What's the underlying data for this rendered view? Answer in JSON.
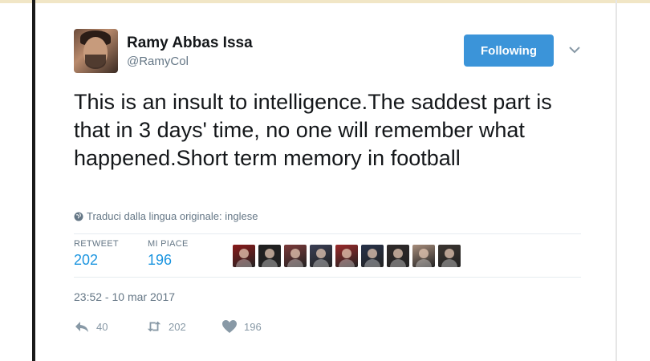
{
  "author": {
    "name": "Ramy Abbas Issa",
    "handle": "@RamyCol",
    "avatar_icon": "profile-photo"
  },
  "follow_button": {
    "label": "Following",
    "color": "#3b94d9"
  },
  "tweet": {
    "text": "This is an insult to intelligence.The saddest part is that in 3 days' time, no one will remember what happened.Short term memory in football",
    "translate_link": "Traduci dalla lingua originale: inglese"
  },
  "stats": {
    "retweets_label": "RETWEET",
    "retweets_count": "202",
    "likes_label": "MI PIACE",
    "likes_count": "196"
  },
  "likers": [
    {
      "icon": "liker-avatar-1",
      "color": "#8a1a1a"
    },
    {
      "icon": "liker-avatar-2",
      "color": "#1f1f1f"
    },
    {
      "icon": "liker-avatar-3",
      "color": "#7c3a3a"
    },
    {
      "icon": "liker-avatar-4",
      "color": "#3a3f55"
    },
    {
      "icon": "liker-avatar-5",
      "color": "#9b2a2a"
    },
    {
      "icon": "liker-avatar-6",
      "color": "#27324a"
    },
    {
      "icon": "liker-avatar-7",
      "color": "#2f2a2a"
    },
    {
      "icon": "liker-avatar-8",
      "color": "#a78d7c"
    },
    {
      "icon": "liker-avatar-9",
      "color": "#3b3530"
    }
  ],
  "timestamp": "23:52 - 10 mar 2017",
  "actions": {
    "reply_count": "40",
    "retweet_count": "202",
    "like_count": "196"
  }
}
